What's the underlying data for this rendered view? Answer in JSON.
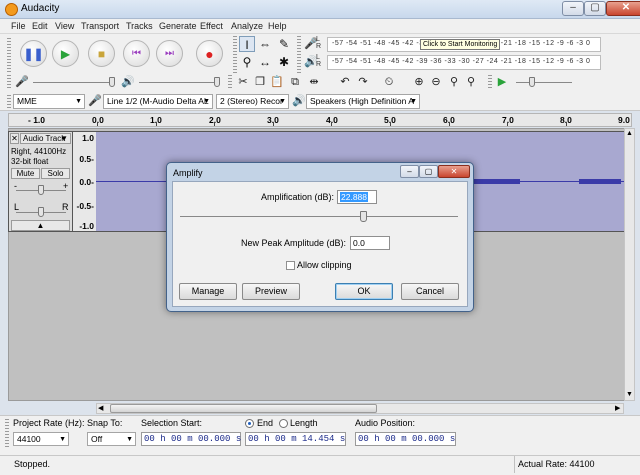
{
  "window": {
    "title": "Audacity",
    "minimize": "–",
    "maximize": "▢",
    "close": "✕"
  },
  "menu": [
    "File",
    "Edit",
    "View",
    "Transport",
    "Tracks",
    "Generate",
    "Effect",
    "Analyze",
    "Help"
  ],
  "meters": {
    "scale": "-57 -54 -51 -48 -45 -42 -39 -36 -33 -30 -27 -24 -21 -18 -15 -12  -9  -6  -3  0",
    "lr": "L\nR",
    "tooltip": "Click to Start Monitoring"
  },
  "devices": {
    "host": "MME",
    "recording_device": "Line 1/2 (M-Audio Delta AL",
    "channels": "2 (Stereo) Recor",
    "playback_device": "Speakers (High Definition A"
  },
  "ruler": {
    "labels": [
      "- 1.0",
      "0.0",
      "1.0",
      "2.0",
      "3.0",
      "4.0",
      "5.0",
      "6.0",
      "7.0",
      "8.0",
      "9.0"
    ]
  },
  "track": {
    "name": "Audio Track",
    "info1": "Right, 44100Hz",
    "info2": "32-bit float",
    "mute": "Mute",
    "solo": "Solo",
    "gain_minus": "-",
    "gain_plus": "+",
    "pan_left": "L",
    "pan_right": "R",
    "collapse": "▲",
    "scale": [
      "1.0",
      "0.5-",
      "0.0-",
      "-0.5-",
      "-1.0"
    ]
  },
  "dialog": {
    "title": "Amplify",
    "amplification_label": "Amplification (dB):",
    "amplification_value": "22.888",
    "slider_level": 0.66,
    "peak_label": "New Peak Amplitude (dB):",
    "peak_value": "0.0",
    "allow_clipping": "Allow clipping",
    "manage": "Manage",
    "preview": "Preview",
    "ok": "OK",
    "cancel": "Cancel"
  },
  "selection_toolbar": {
    "project_rate_label": "Project Rate (Hz):",
    "project_rate": "44100",
    "snap_label": "Snap To:",
    "snap_value": "Off",
    "selection_start_label": "Selection Start:",
    "end_label": "End",
    "length_label": "Length",
    "audio_position_label": "Audio Position:",
    "start_time": "00 h 00 m 00.000 s",
    "end_time": "00 h 00 m 14.454 s",
    "audio_position": "00 h 00 m 00.000 s"
  },
  "status": {
    "left": "Stopped.",
    "right": "Actual Rate: 44100"
  }
}
